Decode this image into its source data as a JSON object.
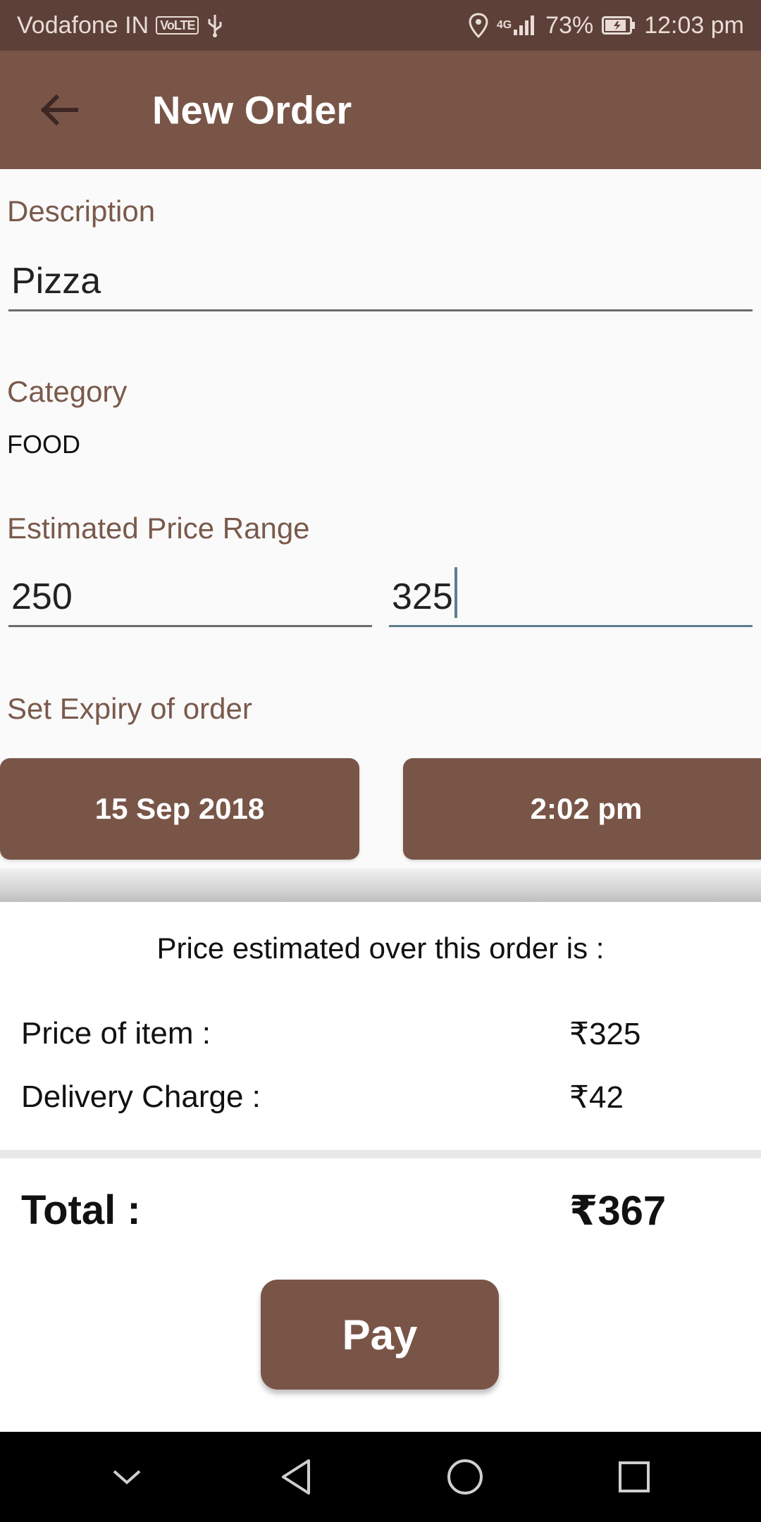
{
  "status_bar": {
    "carrier": "Vodafone IN",
    "volte": "VoLTE",
    "network": "4G",
    "battery": "73%",
    "time": "12:03 pm"
  },
  "app_bar": {
    "title": "New Order"
  },
  "form": {
    "description_label": "Description",
    "description_value": "Pizza",
    "category_label": "Category",
    "category_value": "FOOD",
    "price_range_label": "Estimated Price Range",
    "price_min": "250",
    "price_max": "325",
    "expiry_label": "Set Expiry of order",
    "expiry_date": "15 Sep 2018",
    "expiry_time": "2:02 pm"
  },
  "summary": {
    "header": "Price estimated over this order is :",
    "item_price_label": "Price of item :",
    "item_price_value": "₹325",
    "delivery_label": "Delivery Charge :",
    "delivery_value": "₹42",
    "total_label": "Total :",
    "total_value": "₹367",
    "pay_label": "Pay"
  },
  "colors": {
    "status_bar": "#5d4037",
    "primary": "#795548",
    "label": "#7a5a4c",
    "focus_underline": "#5f7d8e"
  }
}
